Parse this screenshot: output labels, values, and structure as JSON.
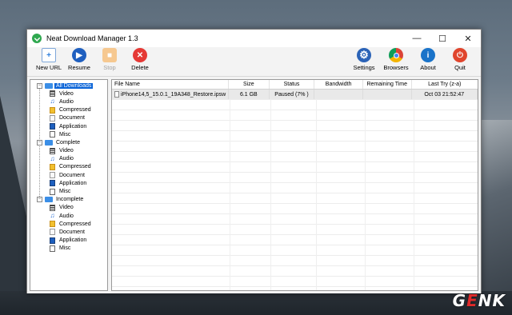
{
  "window": {
    "title": "Neat Download Manager 1.3",
    "controls": {
      "minimize": "—",
      "maximize": "☐",
      "close": "✕"
    }
  },
  "toolbar": {
    "new_url": "New URL",
    "resume": "Resume",
    "stop": "Stop",
    "delete": "Delete",
    "settings": "Settings",
    "browsers": "Browsers",
    "about": "About",
    "quit": "Quit"
  },
  "tree": {
    "groups": [
      {
        "label": "All Downloads",
        "children": [
          "Video",
          "Audio",
          "Compressed",
          "Document",
          "Application",
          "Misc"
        ]
      },
      {
        "label": "Complete",
        "children": [
          "Video",
          "Audio",
          "Compressed",
          "Document",
          "Application",
          "Misc"
        ]
      },
      {
        "label": "Incomplete",
        "children": [
          "Video",
          "Audio",
          "Compressed",
          "Document",
          "Application",
          "Misc"
        ]
      }
    ]
  },
  "list": {
    "columns": {
      "file_name": "File Name",
      "size": "Size",
      "status": "Status",
      "bandwidth": "Bandwidth",
      "remaining_time": "Remaining Time",
      "last_try": "Last Try (z-a)"
    },
    "rows": [
      {
        "file_name": "iPhone14,5_15.0.1_19A348_Restore.ipsw",
        "size": "6.1 GB",
        "status": "Paused (7% )",
        "bandwidth": "",
        "remaining_time": "",
        "last_try": "Oct 03  21:52:47"
      }
    ]
  },
  "watermark": {
    "pre": "G",
    "accent": "E",
    "post": "NK"
  },
  "colors": {
    "selection": "#0a64d8",
    "folder": "#3b8ee6",
    "resume": "#1f5fbf",
    "delete": "#e53935",
    "about": "#1a73c9",
    "quit": "#e0452d"
  }
}
